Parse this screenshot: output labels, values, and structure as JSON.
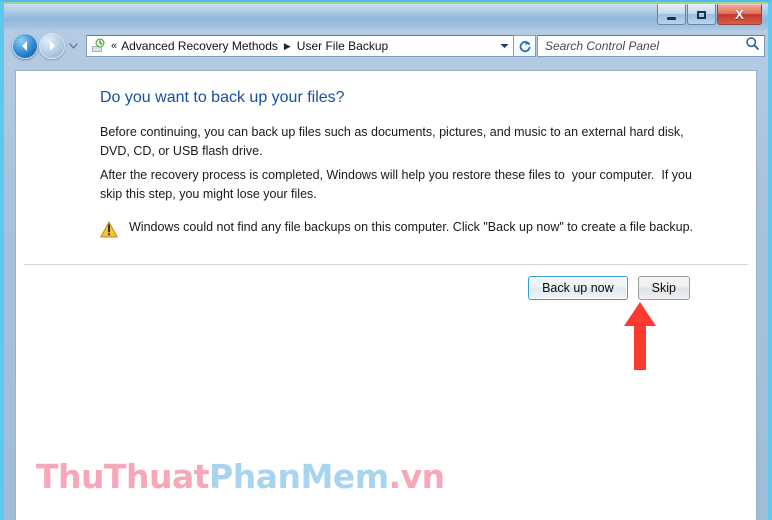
{
  "window": {
    "title": "",
    "controls": {
      "minimize_label": "Minimize",
      "maximize_label": "Maximize",
      "close_label": "X"
    }
  },
  "navigation": {
    "back_label": "Back",
    "forward_label": "Forward",
    "recent_pages_label": "Recent pages",
    "refresh_label": "Refresh",
    "breadcrumb": {
      "overflow_label": "«",
      "separator": "▶",
      "segments": [
        "Advanced Recovery Methods",
        "User File Backup"
      ],
      "dropdown_label": "Previous locations"
    }
  },
  "search": {
    "placeholder": "Search Control Panel",
    "value": "",
    "icon": "search-icon"
  },
  "main": {
    "heading": "Do you want to back up your files?",
    "paragraphs": [
      "Before continuing, you can back up files such as documents, pictures, and music to an external hard disk, DVD, CD, or USB flash drive.",
      "After the recovery process is completed, Windows will help you restore these files to  your computer.  If you skip this step, you might lose your files."
    ],
    "warning": {
      "icon": "warning-triangle-icon",
      "text": "Windows could not find any file backups on this computer. Click \"Back up now\" to create a file backup."
    },
    "buttons": [
      {
        "label": "Back up now",
        "default": true
      },
      {
        "label": "Skip",
        "default": false
      }
    ]
  },
  "annotation": {
    "arrow": "red-up-arrow",
    "arrow_color": "#fb3b30",
    "points_at": "Skip"
  },
  "watermark": {
    "part1": "ThuThuat",
    "part2": "PhanMem",
    "part3": ".vn",
    "color1": "#f7a8b8",
    "color2": "#a8d4f0"
  },
  "colors": {
    "heading": "#14519e",
    "frame_border": "#5fc8ef",
    "default_button_border": "#2f9fd6"
  }
}
